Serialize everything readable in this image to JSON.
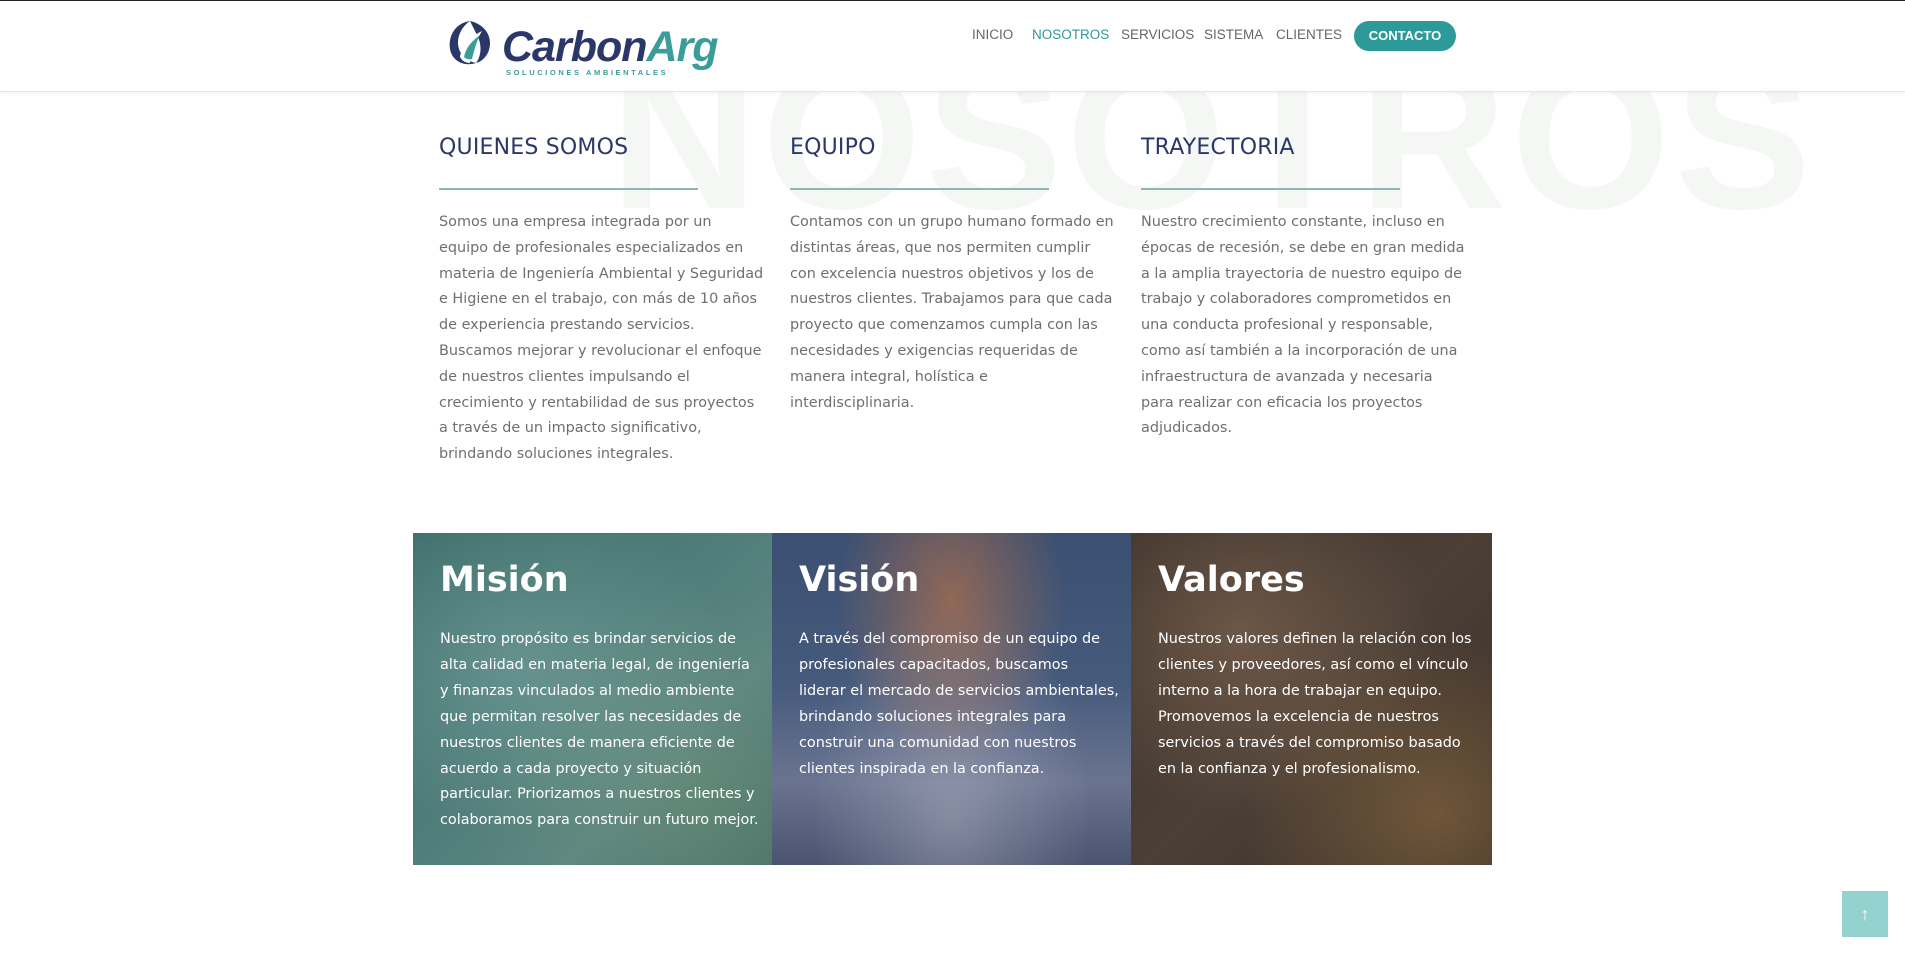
{
  "header": {
    "logo": {
      "name_part1": "Carbon",
      "name_part2": "Arg",
      "tagline": "SOLUCIONES AMBIENTALES"
    },
    "nav": [
      {
        "label": "INICIO",
        "active": false
      },
      {
        "label": "NOSOTROS",
        "active": true
      },
      {
        "label": "SERVICIOS",
        "active": false
      },
      {
        "label": "SISTEMA",
        "active": false
      },
      {
        "label": "CLIENTES",
        "active": false
      }
    ],
    "contact_label": "CONTACTO"
  },
  "watermark": "NOSOTROS",
  "sections": [
    {
      "title": "QUIENES SOMOS",
      "body": "Somos una empresa integrada por un equipo de profesionales especializados en materia de Ingeniería Ambiental y Seguridad e Higiene en el trabajo, con más de 10 años de experiencia prestando servicios.\nBuscamos mejorar y revolucionar el enfoque de nuestros clientes impulsando el crecimiento y rentabilidad de sus proyectos a través de un impacto significativo, brindando soluciones integrales."
    },
    {
      "title": "EQUIPO",
      "body": "Contamos con un grupo humano formado en distintas áreas, que nos permiten cumplir con excelencia nuestros objetivos y los de nuestros clientes. Trabajamos para que cada proyecto que comenzamos cumpla con las necesidades y exigencias requeridas de manera integral, holística e interdisciplinaria."
    },
    {
      "title": "TRAYECTORIA",
      "body": "Nuestro crecimiento constante, incluso en épocas de recesión, se debe en gran medida a la amplia trayectoria de nuestro equipo de trabajo y colaboradores comprometidos en una conducta profesional y responsable, como así también a la incorporación de una infraestructura de avanzada y necesaria para realizar con eficacia los proyectos adjudicados."
    }
  ],
  "cards": [
    {
      "title": "Misión",
      "body": "Nuestro propósito es brindar servicios de alta calidad en materia legal, de ingeniería y finanzas vinculados al medio ambiente que permitan resolver las necesidades de nuestros clientes de manera eficiente de acuerdo a cada proyecto y situación particular. Priorizamos a nuestros clientes y colaboramos para construir un futuro mejor."
    },
    {
      "title": "Visión",
      "body": "A través del compromiso de un equipo de profesionales capacitados, buscamos liderar el mercado de servicios ambientales, brindando soluciones integrales para construir una comunidad con nuestros clientes inspirada en la confianza."
    },
    {
      "title": "Valores",
      "body": "Nuestros valores definen la relación con los clientes y proveedores, así como el vínculo interno a la hora de trabajar en equipo. Promovemos la excelencia de nuestros servicios a través del compromiso basado en la confianza y el profesionalismo."
    }
  ],
  "scroll_top_icon": "arrow-up-icon",
  "colors": {
    "brand_navy": "#2b3768",
    "brand_teal": "#2c9a98",
    "scroll_button": "#93d2cf"
  }
}
